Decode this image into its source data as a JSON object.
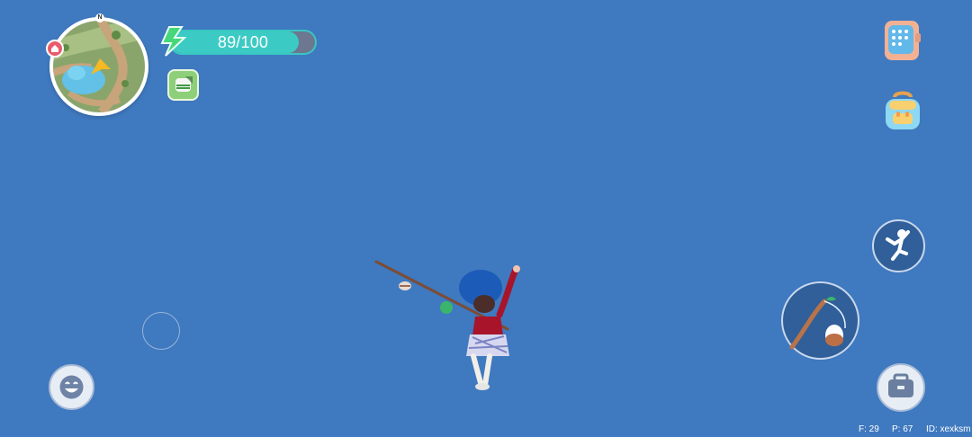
{
  "hud": {
    "compass_label": "N",
    "energy": {
      "value": 89,
      "max": 100,
      "text": "89/100",
      "fill_fraction": 0.89
    },
    "buff_icon": "hamburger-buff-icon"
  },
  "buttons": {
    "phone": "phone-icon",
    "backpack": "backpack-icon",
    "dance": "dance-icon",
    "fishing": "fishing-rod-icon",
    "toolbox": "toolbox-icon",
    "emote": "smile-icon"
  },
  "debug": {
    "f": "F: 29",
    "p": "P: 67",
    "id": "ID: xexksm"
  },
  "colors": {
    "sky": "#3f79bf",
    "energy_fill": "#3ccbc4",
    "energy_bg": "#6d7790",
    "button_dark": "#305f99",
    "button_light": "#e7edf5"
  }
}
